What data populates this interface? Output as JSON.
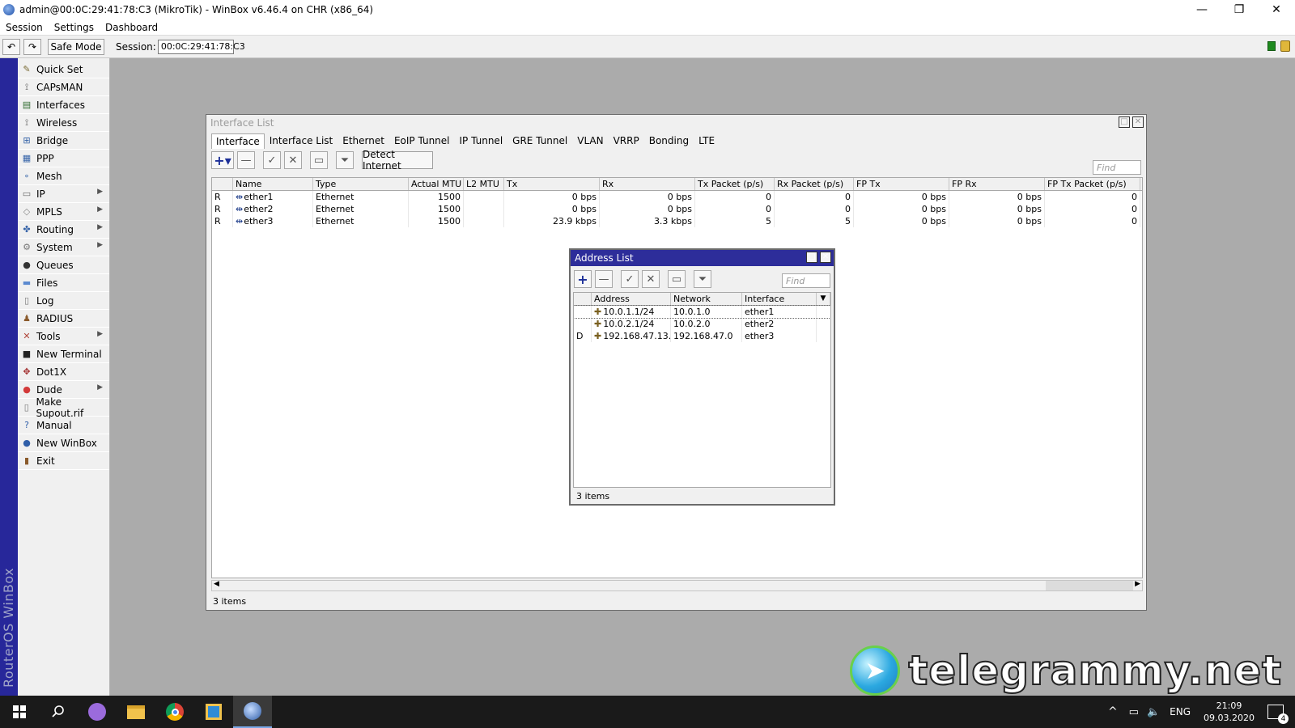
{
  "window": {
    "title": "admin@00:0C:29:41:78:C3 (MikroTik) - WinBox v6.46.4 on CHR (x86_64)",
    "minimize": "—",
    "restore": "❐",
    "close": "✕"
  },
  "menu": [
    "Session",
    "Settings",
    "Dashboard"
  ],
  "toolbar": {
    "undo": "↶",
    "redo": "↷",
    "safe_mode": "Safe Mode",
    "session_label": "Session:",
    "session_value": "00:0C:29:41:78:C3"
  },
  "sidebar_brand": "RouterOS WinBox",
  "sidebar": [
    {
      "label": "Quick Set",
      "icon": "quick-set-icon",
      "glyph": "✎",
      "color": "#7a6b35",
      "submenu": false
    },
    {
      "label": "CAPsMAN",
      "icon": "capsman-icon",
      "glyph": "⟟",
      "color": "#555555",
      "submenu": false
    },
    {
      "label": "Interfaces",
      "icon": "interfaces-icon",
      "glyph": "▤",
      "color": "#2f6b2f",
      "submenu": false
    },
    {
      "label": "Wireless",
      "icon": "wireless-icon",
      "glyph": "⟟",
      "color": "#555555",
      "submenu": false
    },
    {
      "label": "Bridge",
      "icon": "bridge-icon",
      "glyph": "⊞",
      "color": "#3563a8",
      "submenu": false
    },
    {
      "label": "PPP",
      "icon": "ppp-icon",
      "glyph": "▦",
      "color": "#3563a8",
      "submenu": false
    },
    {
      "label": "Mesh",
      "icon": "mesh-icon",
      "glyph": "∘",
      "color": "#3563a8",
      "submenu": false
    },
    {
      "label": "IP",
      "icon": "ip-icon",
      "glyph": "▭",
      "color": "#666666",
      "submenu": true
    },
    {
      "label": "MPLS",
      "icon": "mpls-icon",
      "glyph": "◇",
      "color": "#888888",
      "submenu": true
    },
    {
      "label": "Routing",
      "icon": "routing-icon",
      "glyph": "✤",
      "color": "#3563a8",
      "submenu": true
    },
    {
      "label": "System",
      "icon": "system-icon",
      "glyph": "⚙",
      "color": "#777777",
      "submenu": true
    },
    {
      "label": "Queues",
      "icon": "queues-icon",
      "glyph": "●",
      "color": "#333333",
      "submenu": false
    },
    {
      "label": "Files",
      "icon": "files-icon",
      "glyph": "▬",
      "color": "#5b8ad0",
      "submenu": false
    },
    {
      "label": "Log",
      "icon": "log-icon",
      "glyph": "▯",
      "color": "#777777",
      "submenu": false
    },
    {
      "label": "RADIUS",
      "icon": "radius-icon",
      "glyph": "♟",
      "color": "#8a5a2b",
      "submenu": false
    },
    {
      "label": "Tools",
      "icon": "tools-icon",
      "glyph": "✕",
      "color": "#b0463a",
      "submenu": true
    },
    {
      "label": "New Terminal",
      "icon": "terminal-icon",
      "glyph": "■",
      "color": "#222222",
      "submenu": false
    },
    {
      "label": "Dot1X",
      "icon": "dot1x-icon",
      "glyph": "✥",
      "color": "#a33030",
      "submenu": false
    },
    {
      "label": "Dude",
      "icon": "dude-icon",
      "glyph": "●",
      "color": "#d33a3a",
      "submenu": true
    },
    {
      "label": "Make Supout.rif",
      "icon": "supout-icon",
      "glyph": "▯",
      "color": "#777777",
      "submenu": false
    },
    {
      "label": "Manual",
      "icon": "manual-icon",
      "glyph": "?",
      "color": "#2f5ea8",
      "submenu": false
    },
    {
      "label": "New WinBox",
      "icon": "winbox-icon",
      "glyph": "●",
      "color": "#2f5ea8",
      "submenu": false
    },
    {
      "label": "Exit",
      "icon": "exit-icon",
      "glyph": "▮",
      "color": "#8a5a2b",
      "submenu": false
    }
  ],
  "interface_list": {
    "title": "Interface List",
    "tabs": [
      "Interface",
      "Interface List",
      "Ethernet",
      "EoIP Tunnel",
      "IP Tunnel",
      "GRE Tunnel",
      "VLAN",
      "VRRP",
      "Bonding",
      "LTE"
    ],
    "active_tab": 0,
    "detect_internet": "Detect Internet",
    "find_placeholder": "Find",
    "columns": [
      "",
      "Name",
      "Type",
      "Actual MTU",
      "L2 MTU",
      "Tx",
      "Rx",
      "Tx Packet (p/s)",
      "Rx Packet (p/s)",
      "FP Tx",
      "FP Rx",
      "FP Tx Packet (p/s)"
    ],
    "rows": [
      [
        "R",
        "ether1",
        "Ethernet",
        "1500",
        "",
        "0 bps",
        "0 bps",
        "0",
        "0",
        "0 bps",
        "0 bps",
        "0"
      ],
      [
        "R",
        "ether2",
        "Ethernet",
        "1500",
        "",
        "0 bps",
        "0 bps",
        "0",
        "0",
        "0 bps",
        "0 bps",
        "0"
      ],
      [
        "R",
        "ether3",
        "Ethernet",
        "1500",
        "",
        "23.9 kbps",
        "3.3 kbps",
        "5",
        "5",
        "0 bps",
        "0 bps",
        "0"
      ]
    ],
    "status": "3 items"
  },
  "address_list": {
    "title": "Address List",
    "find_placeholder": "Find",
    "columns": [
      "",
      "Address",
      "Network",
      "Interface"
    ],
    "rows": [
      [
        "",
        "10.0.1.1/24",
        "10.0.1.0",
        "ether1"
      ],
      [
        "",
        "10.0.2.1/24",
        "10.0.2.0",
        "ether2"
      ],
      [
        "D",
        "192.168.47.13...",
        "192.168.47.0",
        "ether3"
      ]
    ],
    "status": "3 items"
  },
  "watermark": "telegrammy.net",
  "taskbar": {
    "lang": "ENG",
    "time": "21:09",
    "date": "09.03.2020",
    "notifications": "4"
  }
}
